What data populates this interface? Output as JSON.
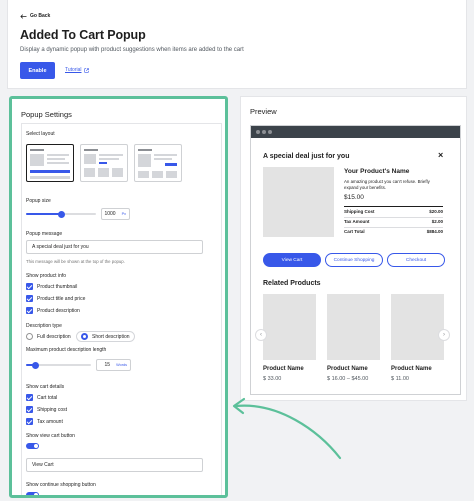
{
  "header": {
    "go_back": "Go Back",
    "title": "Added To Cart Popup",
    "subtitle": "Display a dynamic popup with product suggestions when items are added to the cart",
    "enable_label": "Enable",
    "tutorial_label": "Tutorial"
  },
  "settings": {
    "title": "Popup Settings",
    "select_layout_label": "Select layout",
    "popup_size_label": "Popup size",
    "popup_size_value": "1000",
    "popup_size_unit": "Px",
    "popup_size_fraction": 0.5,
    "popup_message_label": "Popup message",
    "popup_message_value": "A special deal just for you",
    "popup_message_help": "This message will be shown at the top of the popup.",
    "show_product_info_label": "Show product info",
    "product_info_options": [
      "Product thumbnail",
      "Product title and price",
      "Product description"
    ],
    "description_type_label": "Description type",
    "description_types": [
      "Full description",
      "Short description"
    ],
    "description_type_selected": "Short description",
    "max_desc_length_label": "Maximum product description length",
    "max_desc_length_value": "15",
    "max_desc_length_unit": "Words",
    "max_desc_length_fraction": 0.15,
    "show_cart_details_label": "Show cart details",
    "cart_details_options": [
      "Cart total",
      "Shipping cost",
      "Tax amount"
    ],
    "show_view_cart_label": "Show view cart button",
    "view_cart_value": "View Cart",
    "show_continue_shopping_label": "Show continue shopping button"
  },
  "preview": {
    "title": "Preview",
    "popup_heading": "A special deal just for you",
    "close_glyph": "×",
    "product_name": "Your Product's Name",
    "product_desc": "An amazing product you can't refuse. Briefly expand your benefits.",
    "product_price": "$15.00",
    "summary": [
      {
        "label": "Shipping Cost",
        "value": "$20.00"
      },
      {
        "label": "Tax Amount",
        "value": "$2.00"
      },
      {
        "label": "Cart Total",
        "value": "$884.00"
      }
    ],
    "buttons": {
      "view_cart": "View Cart",
      "continue_shopping": "Continue Shopping",
      "checkout": "Checkout"
    },
    "related_title": "Related Products",
    "related": [
      {
        "name": "Product Name",
        "price": "$ 33.00"
      },
      {
        "name": "Product Name",
        "price": "$ 16.00 – $45.00"
      },
      {
        "name": "Product Name",
        "price": "$ 11.00"
      }
    ],
    "prev_glyph": "‹",
    "next_glyph": "›"
  },
  "colors": {
    "accent": "#3858e9",
    "highlight_border": "#5cc09a",
    "browser_bar": "#3c434a"
  }
}
